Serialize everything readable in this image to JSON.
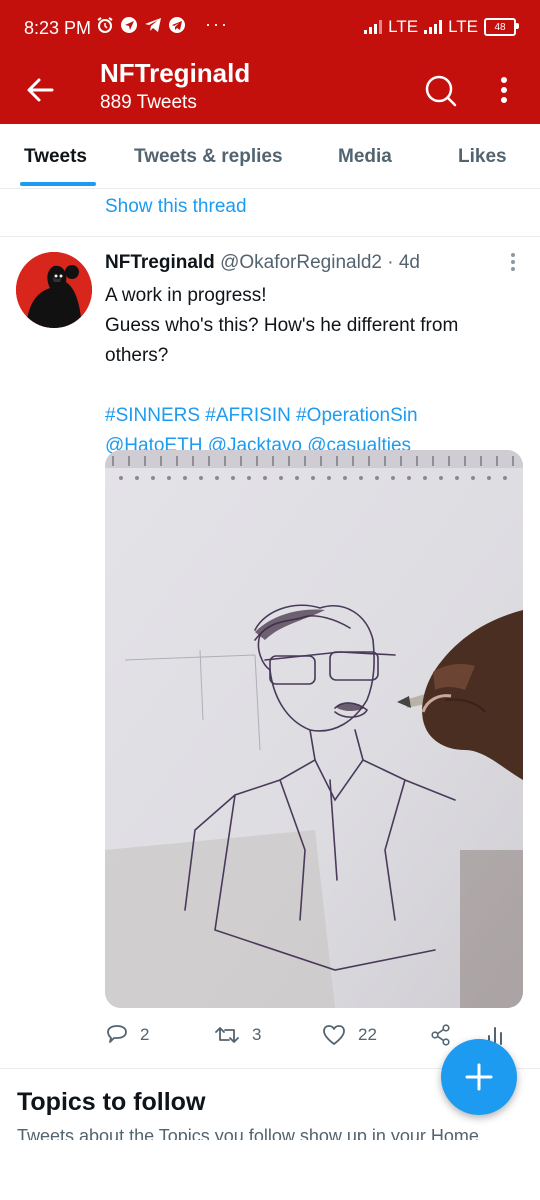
{
  "status_bar": {
    "time": "8:23 PM",
    "dots": "···",
    "network1": "LTE",
    "network2": "LTE",
    "battery": "48"
  },
  "header": {
    "title": "NFTreginald",
    "subtitle": "889 Tweets"
  },
  "tabs": [
    "Tweets",
    "Tweets & replies",
    "Media",
    "Likes"
  ],
  "show_thread": "Show this thread",
  "tweet": {
    "name": "NFTreginald",
    "handle": "@OkaforReginald2",
    "time": "· 4d",
    "lines": [
      "A work in progress!",
      "Guess who's this? How's he different from",
      "others?"
    ],
    "hashtags": "#SINNERS #AFRISIN #OperationSin",
    "mentions": "@HatoETH @Jacktavo @casualties",
    "replies": "2",
    "retweets": "3",
    "likes": "22"
  },
  "topics": {
    "title": "Topics to follow",
    "subtitle": "Tweets about the Topics you follow show up in your Home"
  },
  "colors": {
    "brand_red": "#c4100d",
    "accent_blue": "#1d9bf0",
    "text_gray": "#536471"
  }
}
